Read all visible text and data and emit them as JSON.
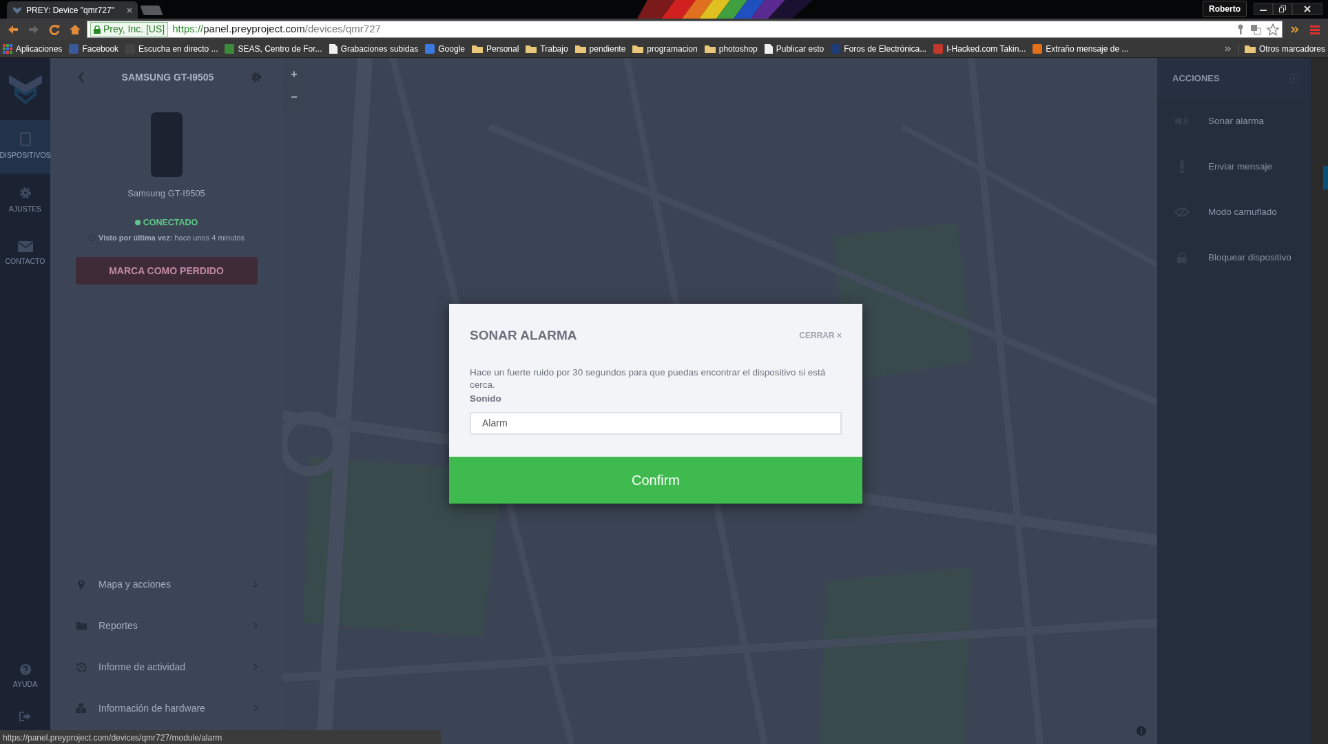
{
  "browser": {
    "tab_title": "PREY: Device \"qmr727\"",
    "profile": "Roberto",
    "address": {
      "secure": true,
      "identity": "Prey, Inc. [US]",
      "scheme": "https://",
      "host": "panel.preyproject.com",
      "path": "/devices/qmr727"
    },
    "bookmarks": [
      {
        "kind": "apps",
        "label": "Aplicaciones"
      },
      {
        "kind": "site",
        "label": "Facebook",
        "color": "#3b5998"
      },
      {
        "kind": "site",
        "label": "Escucha en directo ...",
        "color": "#444444"
      },
      {
        "kind": "site",
        "label": "SEAS, Centro de For...",
        "color": "#3c8a3c"
      },
      {
        "kind": "page",
        "label": "Grabaciones subidas"
      },
      {
        "kind": "site",
        "label": "Google",
        "color": "#3a7ae0"
      },
      {
        "kind": "folder",
        "label": "Personal"
      },
      {
        "kind": "folder",
        "label": "Trabajo"
      },
      {
        "kind": "folder",
        "label": "pendiente"
      },
      {
        "kind": "folder",
        "label": "programacion"
      },
      {
        "kind": "folder",
        "label": "photoshop"
      },
      {
        "kind": "page",
        "label": "Publicar esto"
      },
      {
        "kind": "site",
        "label": "Foros de Electrónica...",
        "color": "#1d3c78"
      },
      {
        "kind": "site",
        "label": "I-Hacked.com Takin...",
        "color": "#c0392b"
      },
      {
        "kind": "site",
        "label": "Extraño mensaje de ...",
        "color": "#e0701a"
      }
    ],
    "other_bookmarks": "Otros marcadores",
    "status_url": "https://panel.preyproject.com/devices/qmr727/module/alarm"
  },
  "nav": {
    "top": [
      {
        "kind": "devices",
        "label": "DISPOSITIVOS",
        "selected": true
      },
      {
        "kind": "settings",
        "label": "AJUSTES",
        "selected": false
      },
      {
        "kind": "contact",
        "label": "CONTACTO",
        "selected": false
      }
    ],
    "bottom": [
      {
        "kind": "help",
        "label": "AYUDA",
        "selected": false
      },
      {
        "kind": "logout",
        "selected": false
      }
    ]
  },
  "device": {
    "title": "SAMSUNG GT-I9505",
    "name": "Samsung GT-I9505",
    "online": true,
    "status": "CONECTADO",
    "last_seen": "**Visto por última vez:** hace unos 4 minutos",
    "lost_button": "MARCA COMO PERDIDO",
    "menu": [
      {
        "kind": "pin",
        "label": "Mapa y acciones"
      },
      {
        "kind": "folder",
        "label": "Reportes"
      },
      {
        "kind": "history",
        "label": "Informe de actividad"
      },
      {
        "kind": "hardware",
        "label": "Información de hardware"
      }
    ]
  },
  "actions": {
    "title": "ACCIONES",
    "items": [
      {
        "kind": "alarm",
        "label": "Sonar alarma"
      },
      {
        "kind": "message",
        "label": "Enviar mensaje"
      },
      {
        "kind": "hide",
        "label": "Modo camuflado"
      },
      {
        "kind": "lock",
        "label": "Bloquear dispositivo"
      }
    ]
  },
  "map": {
    "kind": "picture",
    "zoom_in": "+",
    "zoom_out": "−"
  },
  "modal": {
    "title": "SONAR ALARMA",
    "close": "CERRAR ×",
    "description": "Hace un fuerte ruido por 30 segundos para que puedas encontrar el dispositivo si está cerca.",
    "field_label": "Sonido",
    "field_value": "Alarm",
    "confirm": "Confirm"
  }
}
